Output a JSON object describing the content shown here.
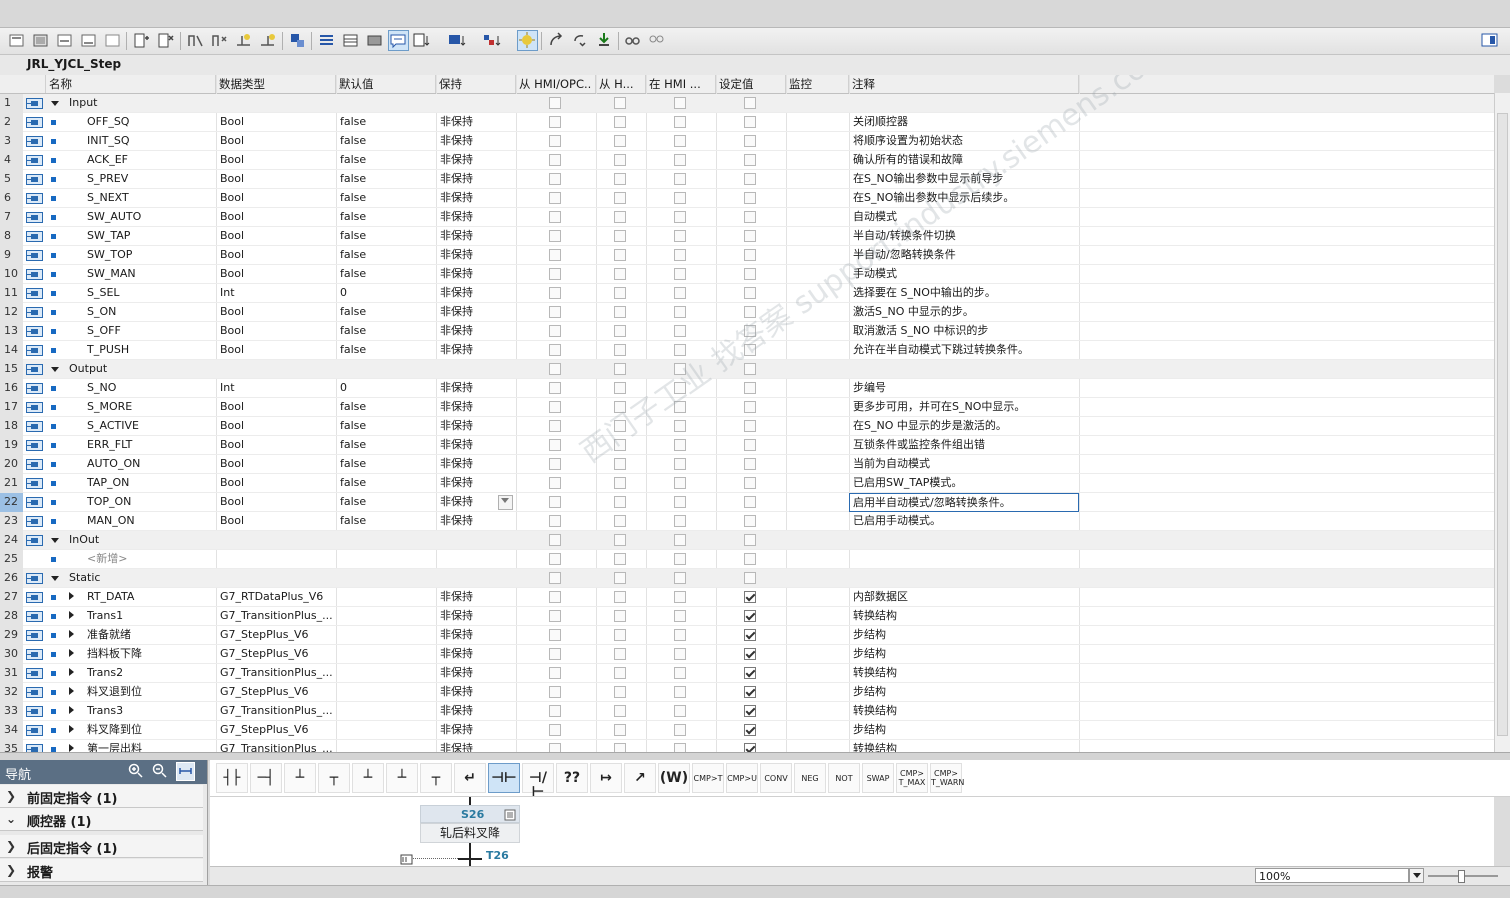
{
  "block_title": "JRL_YJCL_Step",
  "columns": {
    "name": "名称",
    "type": "数据类型",
    "default": "默认值",
    "retain": "保持",
    "hmi_opc": "从 HMI/OPC..",
    "hmi_h": "从 H...",
    "in_hmi": "在 HMI ...",
    "setpoint": "设定值",
    "monitor": "监控",
    "comment": "注释"
  },
  "rows": [
    {
      "no": "1",
      "kind": "section",
      "name": "Input",
      "type": "",
      "default": "",
      "retain": "",
      "setpoint": false,
      "comment": ""
    },
    {
      "no": "2",
      "kind": "var",
      "name": "OFF_SQ",
      "type": "Bool",
      "default": "false",
      "retain": "非保持",
      "setpoint": false,
      "comment": "关闭顺控器"
    },
    {
      "no": "3",
      "kind": "var",
      "name": "INIT_SQ",
      "type": "Bool",
      "default": "false",
      "retain": "非保持",
      "setpoint": false,
      "comment": "将顺序设置为初始状态"
    },
    {
      "no": "4",
      "kind": "var",
      "name": "ACK_EF",
      "type": "Bool",
      "default": "false",
      "retain": "非保持",
      "setpoint": false,
      "comment": "确认所有的错误和故障"
    },
    {
      "no": "5",
      "kind": "var",
      "name": "S_PREV",
      "type": "Bool",
      "default": "false",
      "retain": "非保持",
      "setpoint": false,
      "comment": "在S_NO输出参数中显示前导步"
    },
    {
      "no": "6",
      "kind": "var",
      "name": "S_NEXT",
      "type": "Bool",
      "default": "false",
      "retain": "非保持",
      "setpoint": false,
      "comment": "在S_NO输出参数中显示后续步。"
    },
    {
      "no": "7",
      "kind": "var",
      "name": "SW_AUTO",
      "type": "Bool",
      "default": "false",
      "retain": "非保持",
      "setpoint": false,
      "comment": "自动模式"
    },
    {
      "no": "8",
      "kind": "var",
      "name": "SW_TAP",
      "type": "Bool",
      "default": "false",
      "retain": "非保持",
      "setpoint": false,
      "comment": "半自动/转换条件切换"
    },
    {
      "no": "9",
      "kind": "var",
      "name": "SW_TOP",
      "type": "Bool",
      "default": "false",
      "retain": "非保持",
      "setpoint": false,
      "comment": "半自动/忽略转换条件"
    },
    {
      "no": "10",
      "kind": "var",
      "name": "SW_MAN",
      "type": "Bool",
      "default": "false",
      "retain": "非保持",
      "setpoint": false,
      "comment": "手动模式"
    },
    {
      "no": "11",
      "kind": "var",
      "name": "S_SEL",
      "type": "Int",
      "default": "0",
      "retain": "非保持",
      "setpoint": false,
      "comment": "选择要在 S_NO中输出的步。"
    },
    {
      "no": "12",
      "kind": "var",
      "name": "S_ON",
      "type": "Bool",
      "default": "false",
      "retain": "非保持",
      "setpoint": false,
      "comment": "激活S_NO 中显示的步。"
    },
    {
      "no": "13",
      "kind": "var",
      "name": "S_OFF",
      "type": "Bool",
      "default": "false",
      "retain": "非保持",
      "setpoint": false,
      "comment": "取消激活 S_NO 中标识的步"
    },
    {
      "no": "14",
      "kind": "var",
      "name": "T_PUSH",
      "type": "Bool",
      "default": "false",
      "retain": "非保持",
      "setpoint": false,
      "comment": "允许在半自动模式下跳过转换条件。"
    },
    {
      "no": "15",
      "kind": "section",
      "name": "Output",
      "type": "",
      "default": "",
      "retain": "",
      "setpoint": false,
      "comment": ""
    },
    {
      "no": "16",
      "kind": "var",
      "name": "S_NO",
      "type": "Int",
      "default": "0",
      "retain": "非保持",
      "setpoint": false,
      "comment": "步编号"
    },
    {
      "no": "17",
      "kind": "var",
      "name": "S_MORE",
      "type": "Bool",
      "default": "false",
      "retain": "非保持",
      "setpoint": false,
      "comment": "更多步可用，并可在S_NO中显示。"
    },
    {
      "no": "18",
      "kind": "var",
      "name": "S_ACTIVE",
      "type": "Bool",
      "default": "false",
      "retain": "非保持",
      "setpoint": false,
      "comment": "在S_NO 中显示的步是激活的。"
    },
    {
      "no": "19",
      "kind": "var",
      "name": "ERR_FLT",
      "type": "Bool",
      "default": "false",
      "retain": "非保持",
      "setpoint": false,
      "comment": "互锁条件或监控条件组出错"
    },
    {
      "no": "20",
      "kind": "var",
      "name": "AUTO_ON",
      "type": "Bool",
      "default": "false",
      "retain": "非保持",
      "setpoint": false,
      "comment": "当前为自动模式"
    },
    {
      "no": "21",
      "kind": "var",
      "name": "TAP_ON",
      "type": "Bool",
      "default": "false",
      "retain": "非保持",
      "setpoint": false,
      "comment": "已启用SW_TAP模式。"
    },
    {
      "no": "22",
      "kind": "var",
      "name": "TOP_ON",
      "type": "Bool",
      "default": "false",
      "retain": "非保持",
      "setpoint": false,
      "comment": "启用半自动模式/忽略转换条件。",
      "selected": true
    },
    {
      "no": "23",
      "kind": "var",
      "name": "MAN_ON",
      "type": "Bool",
      "default": "false",
      "retain": "非保持",
      "setpoint": false,
      "comment": "已启用手动模式。"
    },
    {
      "no": "24",
      "kind": "section",
      "name": "InOut",
      "type": "",
      "default": "",
      "retain": "",
      "setpoint": false,
      "comment": ""
    },
    {
      "no": "25",
      "kind": "new",
      "name": "<新增>",
      "type": "",
      "default": "",
      "retain": "",
      "setpoint": false,
      "comment": ""
    },
    {
      "no": "26",
      "kind": "section",
      "name": "Static",
      "type": "",
      "default": "",
      "retain": "",
      "setpoint": false,
      "comment": ""
    },
    {
      "no": "27",
      "kind": "struct",
      "name": "RT_DATA",
      "type": "G7_RTDataPlus_V6",
      "default": "",
      "retain": "非保持",
      "setpoint": true,
      "comment": "内部数据区"
    },
    {
      "no": "28",
      "kind": "struct",
      "name": "Trans1",
      "type": "G7_TransitionPlus_...",
      "default": "",
      "retain": "非保持",
      "setpoint": true,
      "comment": "转换结构"
    },
    {
      "no": "29",
      "kind": "struct",
      "name": "准备就绪",
      "type": "G7_StepPlus_V6",
      "default": "",
      "retain": "非保持",
      "setpoint": true,
      "comment": "步结构"
    },
    {
      "no": "30",
      "kind": "struct",
      "name": "挡料板下降",
      "type": "G7_StepPlus_V6",
      "default": "",
      "retain": "非保持",
      "setpoint": true,
      "comment": "步结构"
    },
    {
      "no": "31",
      "kind": "struct",
      "name": "Trans2",
      "type": "G7_TransitionPlus_...",
      "default": "",
      "retain": "非保持",
      "setpoint": true,
      "comment": "转换结构"
    },
    {
      "no": "32",
      "kind": "struct",
      "name": "料叉退到位",
      "type": "G7_StepPlus_V6",
      "default": "",
      "retain": "非保持",
      "setpoint": true,
      "comment": "步结构"
    },
    {
      "no": "33",
      "kind": "struct",
      "name": "Trans3",
      "type": "G7_TransitionPlus_...",
      "default": "",
      "retain": "非保持",
      "setpoint": true,
      "comment": "转换结构"
    },
    {
      "no": "34",
      "kind": "struct",
      "name": "料叉降到位",
      "type": "G7_StepPlus_V6",
      "default": "",
      "retain": "非保持",
      "setpoint": true,
      "comment": "步结构"
    },
    {
      "no": "35",
      "kind": "struct",
      "name": "第一层出料",
      "type": "G7_TransitionPlus_...",
      "default": "",
      "retain": "非保持",
      "setpoint": true,
      "comment": "转换结构"
    }
  ],
  "nav": {
    "title": "导航",
    "items": [
      {
        "arrow": "❯",
        "label": "前固定指令 (1)"
      },
      {
        "arrow": "⌄",
        "label": "顺控器 (1)"
      },
      {
        "arrow": "❯",
        "label": "后固定指令 (1)"
      },
      {
        "arrow": "❯",
        "label": "报警"
      }
    ]
  },
  "instructions": [
    "",
    "",
    "",
    "",
    "",
    "",
    "",
    "",
    "",
    "",
    "",
    "",
    "",
    "",
    "CMP>T",
    "CMP>U",
    "CONV",
    "NEG",
    "NOT",
    "SWAP",
    "CMP>\nT_MAX",
    "CMP>\nT_WARN"
  ],
  "graph": {
    "step": "S26",
    "step_name": "轧后料叉降",
    "transition": "T26"
  },
  "zoom": "100%",
  "watermark": "西门子工业 找答案 support.industry.siemens.com/cs"
}
